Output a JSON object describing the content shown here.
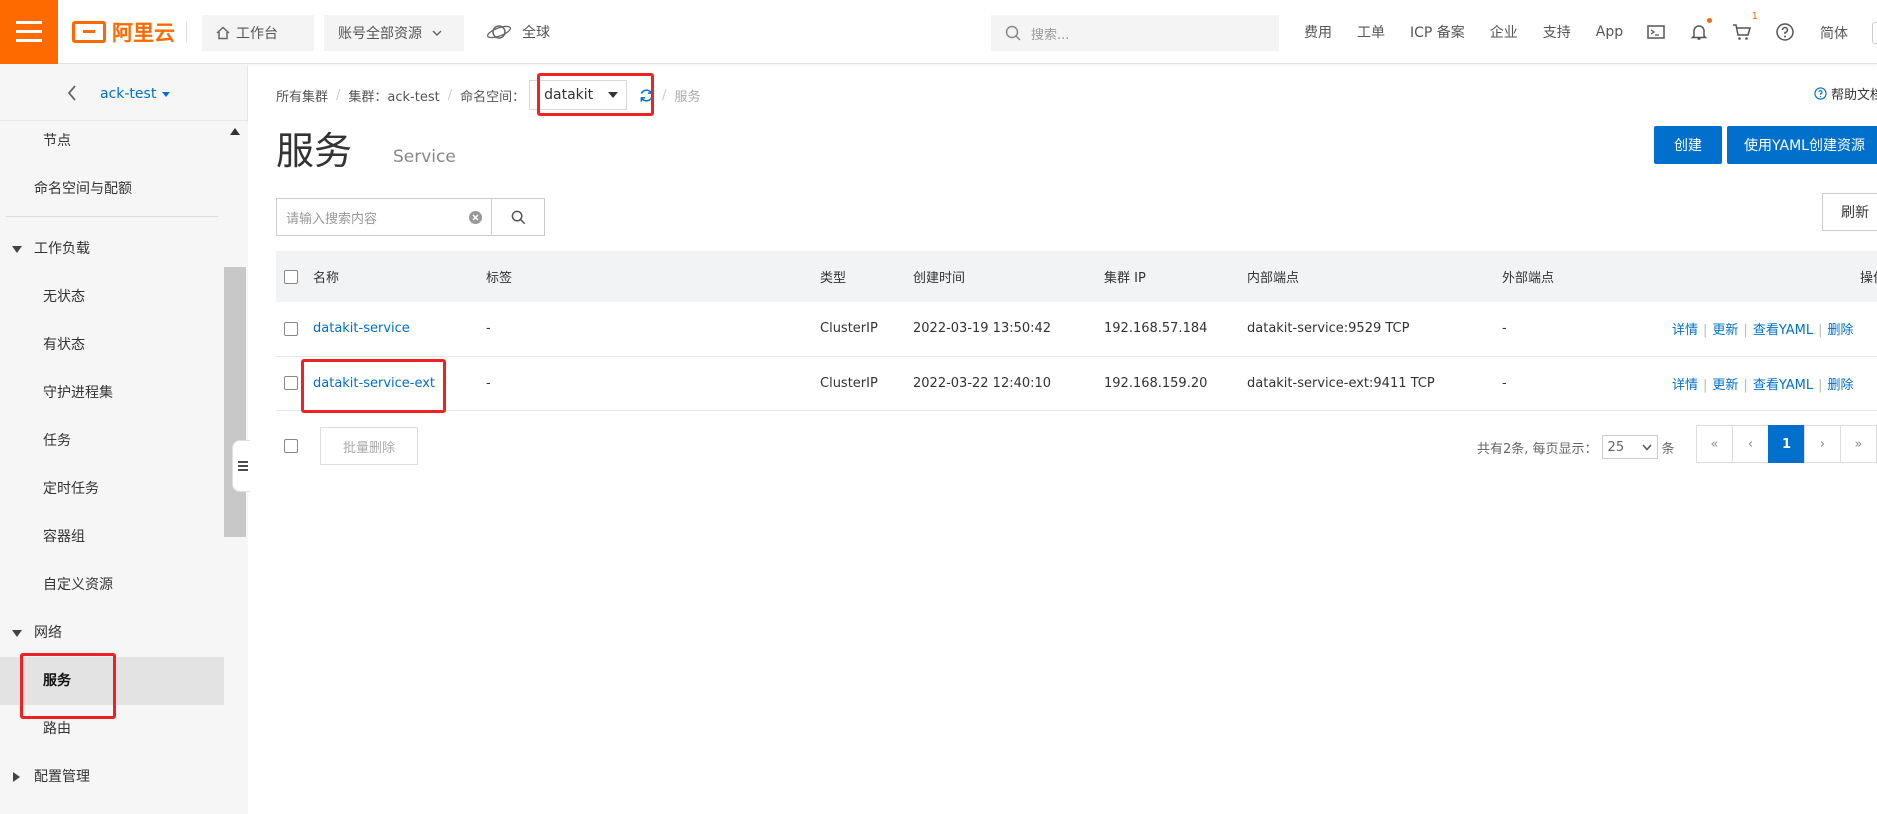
{
  "topbar": {
    "brand": "阿里云",
    "workbench_label": "工作台",
    "resources_label": "账号全部资源",
    "region_label": "全球",
    "search_placeholder": "搜索...",
    "links": [
      "费用",
      "工单",
      "ICP 备案",
      "企业",
      "支持",
      "App"
    ],
    "cart_badge": "1",
    "language": "简体"
  },
  "sidebar": {
    "cluster_name": "ack-test",
    "items": [
      {
        "label": "节点"
      },
      {
        "label": "命名空间与配额"
      },
      {
        "label": "工作负载"
      },
      {
        "label": "无状态"
      },
      {
        "label": "有状态"
      },
      {
        "label": "守护进程集"
      },
      {
        "label": "任务"
      },
      {
        "label": "定时任务"
      },
      {
        "label": "容器组"
      },
      {
        "label": "自定义资源"
      },
      {
        "label": "网络"
      },
      {
        "label": "服务"
      },
      {
        "label": "路由"
      },
      {
        "label": "配置管理"
      }
    ],
    "active": "服务"
  },
  "breadcrumb": {
    "all_clusters": "所有集群",
    "cluster": "集群：ack-test",
    "namespace_label": "命名空间：",
    "namespace_value": "datakit",
    "current": "服务"
  },
  "help_label": "帮助文档",
  "page": {
    "title": "服务",
    "subtitle": "Service",
    "create_label": "创建",
    "yaml_create_label": "使用YAML创建资源",
    "search_placeholder": "请输入搜索内容",
    "refresh_label": "刷新"
  },
  "table": {
    "headers": {
      "name": "名称",
      "labels": "标签",
      "type": "类型",
      "created": "创建时间",
      "cluster_ip": "集群 IP",
      "internal": "内部端点",
      "external": "外部端点",
      "actions": "操作"
    },
    "rows": [
      {
        "name": "datakit-service",
        "labels": "-",
        "type": "ClusterIP",
        "created": "2022-03-19 13:50:42",
        "cluster_ip": "192.168.57.184",
        "internal": "datakit-service:9529 TCP",
        "external": "-"
      },
      {
        "name": "datakit-service-ext",
        "labels": "-",
        "type": "ClusterIP",
        "created": "2022-03-22 12:40:10",
        "cluster_ip": "192.168.159.20",
        "internal": "datakit-service-ext:9411 TCP",
        "external": "-"
      }
    ],
    "row_actions": [
      "详情",
      "更新",
      "查看YAML",
      "删除"
    ],
    "batch_delete_label": "批量删除"
  },
  "pagination": {
    "summary": "共有2条, 每页显示：",
    "page_size": "25",
    "unit": "条",
    "first": "«",
    "prev": "‹",
    "current": "1",
    "next": "›",
    "last": "»"
  },
  "colors": {
    "brand": "#ff6a00",
    "primary": "#0070cc",
    "highlight": "#ee2222"
  }
}
